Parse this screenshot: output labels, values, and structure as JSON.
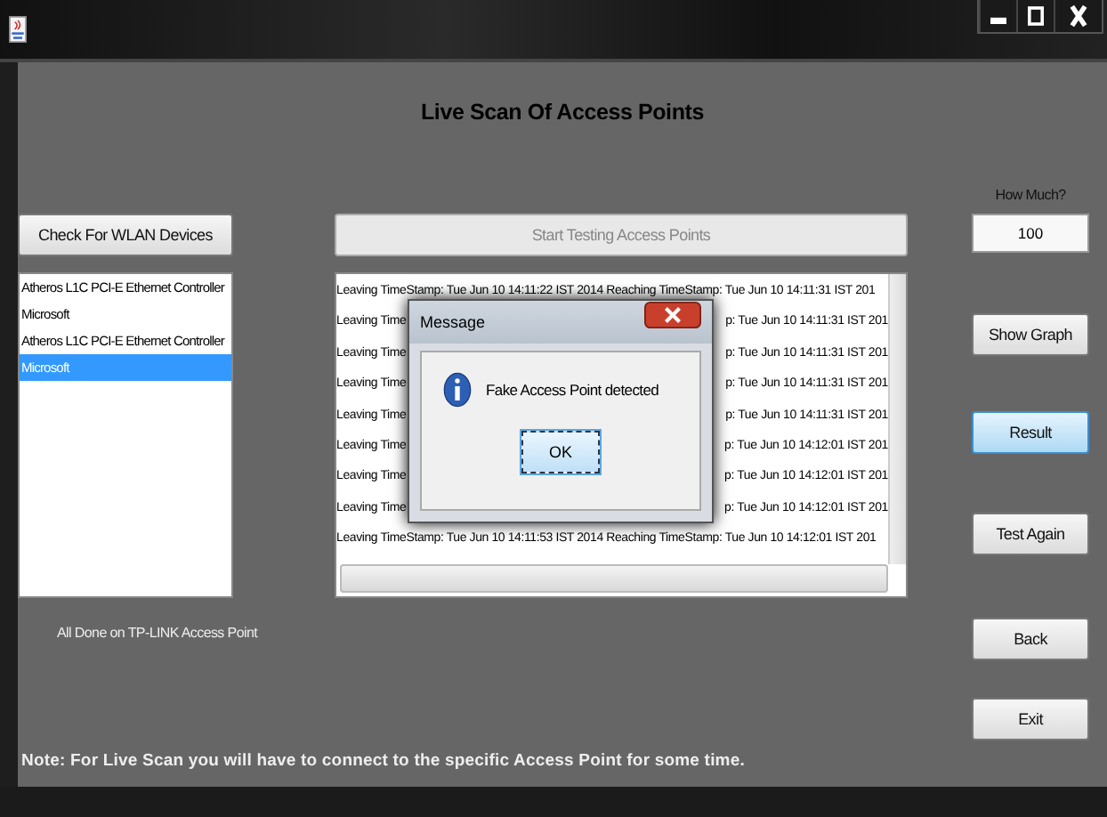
{
  "app": {
    "heading": "Live Scan Of Access Points",
    "how_much": {
      "label": "How Much?",
      "value": "100"
    }
  },
  "top_buttons": [
    {
      "label": "Check For WLAN Devices",
      "disabled": false
    },
    {
      "label": "Start Testing Access Points",
      "disabled": true
    }
  ],
  "devices": [
    {
      "label": "Atheros L1C PCI-E Ethernet Controller",
      "selected": false
    },
    {
      "label": "Microsoft",
      "selected": false
    },
    {
      "label": "Atheros L1C PCI-E Ethernet Controller",
      "selected": false
    },
    {
      "label": "Microsoft",
      "selected": true
    }
  ],
  "log": [
    {
      "kind": "full",
      "text": "Leaving TimeStamp: Tue Jun 10 14:11:22 IST 2014 Reaching TimeStamp: Tue Jun 10 14:11:31 IST 201"
    },
    {
      "kind": "split",
      "left": "Leaving Time",
      "right": "p: Tue Jun 10 14:11:31 IST 201"
    },
    {
      "kind": "split",
      "left": "Leaving Time",
      "right": "p: Tue Jun 10 14:11:31 IST 201"
    },
    {
      "kind": "split",
      "left": "Leaving Time",
      "right": "p: Tue Jun 10 14:11:31 IST 201"
    },
    {
      "kind": "split",
      "left": "Leaving Time",
      "right": "p: Tue Jun 10 14:11:31 IST 201"
    },
    {
      "kind": "split",
      "left": "Leaving Time",
      "right": "p: Tue Jun 10 14:12:01 IST 201"
    },
    {
      "kind": "split",
      "left": "Leaving Time",
      "right": "p: Tue Jun 10 14:12:01 IST 201"
    },
    {
      "kind": "split",
      "left": "Leaving Time",
      "right": "p: Tue Jun 10 14:12:01 IST 201"
    },
    {
      "kind": "full",
      "text": "Leaving TimeStamp: Tue Jun 10 14:11:53 IST 2014 Reaching TimeStamp: Tue Jun 10 14:12:01 IST 201"
    }
  ],
  "side_buttons": [
    {
      "label": "Show Graph",
      "highlighted": false
    },
    {
      "label": "Result",
      "highlighted": true
    },
    {
      "label": "Test Again",
      "highlighted": false
    },
    {
      "label": "Back",
      "highlighted": false
    },
    {
      "label": "Exit",
      "highlighted": false
    }
  ],
  "status": "All Done on TP-LINK Access Point",
  "note": "Note: For Live Scan you will have to connect to the specific Access Point for some time.",
  "dialog": {
    "title": "Message",
    "message": "Fake Access Point detected",
    "button": "OK"
  }
}
